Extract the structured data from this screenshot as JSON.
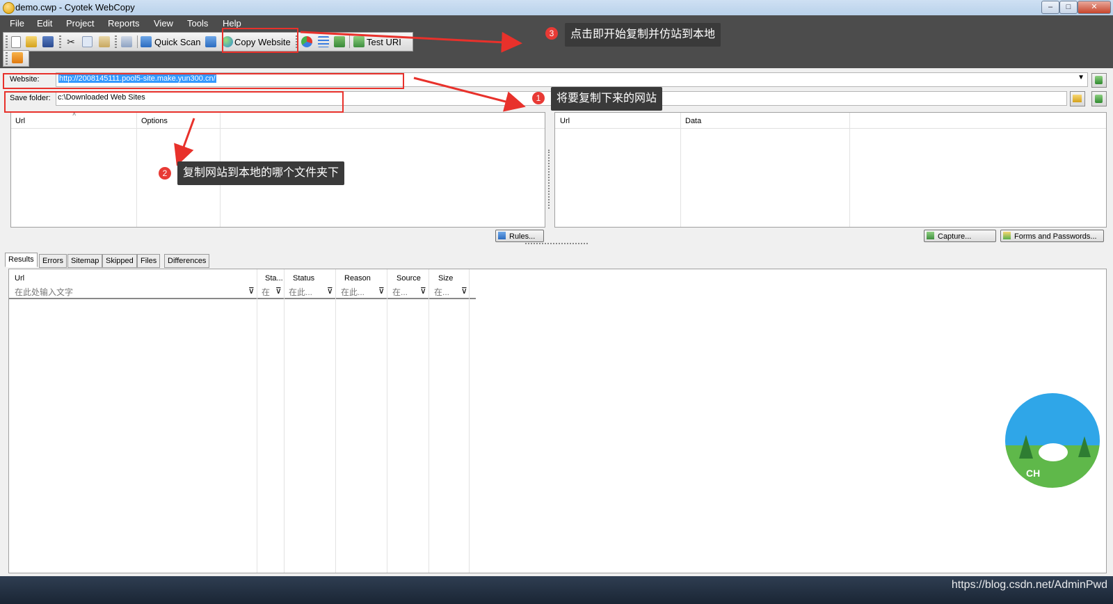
{
  "window": {
    "title": "demo.cwp - Cyotek WebCopy",
    "min": "‒",
    "max": "□",
    "close": "✕"
  },
  "menu": [
    "File",
    "Edit",
    "Project",
    "Reports",
    "View",
    "Tools",
    "Help"
  ],
  "toolbar": {
    "quick_scan": "Quick Scan",
    "copy_website": "Copy Website",
    "test_uri": "Test URI"
  },
  "address": {
    "website_label": "Website:",
    "website_value": "http://2008145111.pool5-site.make.yun300.cn/",
    "save_label": "Save folder:",
    "save_value": "c:\\Downloaded Web Sites"
  },
  "left_panel": {
    "columns": [
      "Url",
      "Options"
    ],
    "button": "Rules..."
  },
  "right_panel": {
    "columns": [
      "Url",
      "Data"
    ],
    "buttons": [
      "Capture...",
      "Forms and Passwords..."
    ]
  },
  "tabs": [
    "Results",
    "Errors",
    "Sitemap",
    "Skipped",
    "Files",
    "Differences"
  ],
  "results": {
    "columns": [
      "Url",
      "Sta...",
      "Status",
      "Reason",
      "Source",
      "Size"
    ],
    "filters": [
      "在此处输入文字",
      "在",
      "在此...",
      "在此...",
      "在...",
      "在..."
    ]
  },
  "annotations": [
    {
      "num": "1",
      "text": "将要复制下来的网站"
    },
    {
      "num": "2",
      "text": "复制网站到本地的哪个文件夹下"
    },
    {
      "num": "3",
      "text": "点击即开始复制并仿站到本地"
    }
  ],
  "mascot": {
    "text": "CH"
  },
  "watermark": "https://blog.csdn.net/AdminPwd",
  "colors": {
    "annotation_red": "#e8312b",
    "callout_bg": "#3a3a3a",
    "selection_blue": "#3399ff",
    "darkband": "#4c4c4c"
  }
}
